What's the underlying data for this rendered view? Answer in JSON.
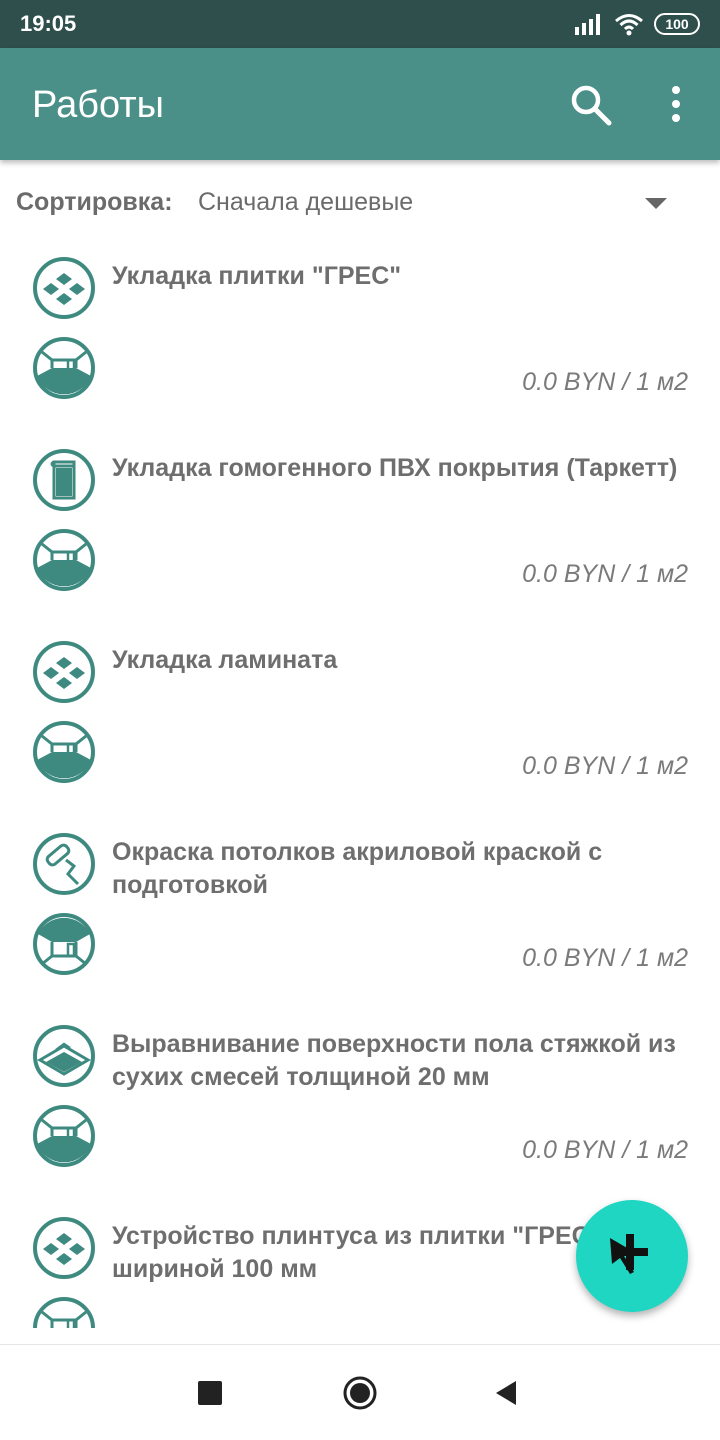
{
  "status_bar": {
    "time": "19:05",
    "battery": "100",
    "icons": [
      "signal-icon",
      "wifi-icon",
      "battery-icon"
    ]
  },
  "app_bar": {
    "title": "Работы",
    "actions": [
      "search-icon",
      "more-vert-icon"
    ],
    "color": "#4a8f88"
  },
  "sort": {
    "label": "Сортировка:",
    "value": "Сначала дешевые"
  },
  "items": [
    {
      "name": "Укладка плитки \"ГРЕС\"",
      "price": "0.0 BYN / 1 м2",
      "category_icon": "tiles-icon",
      "room_icon": "room-icon"
    },
    {
      "name": "Укладка гомогенного ПВХ покрытия (Таркетт)",
      "price": "0.0 BYN / 1 м2",
      "category_icon": "roll-covering-icon",
      "room_icon": "room-icon"
    },
    {
      "name": "Укладка ламината",
      "price": "0.0 BYN / 1 м2",
      "category_icon": "tiles-icon",
      "room_icon": "room-icon"
    },
    {
      "name": "Окраска потолков акриловой краской с подготовкой",
      "price": "0.0 BYN / 1 м2",
      "category_icon": "paint-roller-icon",
      "room_icon": "room-ceiling-icon"
    },
    {
      "name": "Выравнивание поверхности пола стяжкой из сухих смесей толщиной 20 мм",
      "price": "0.0 BYN / 1 м2",
      "category_icon": "screed-icon",
      "room_icon": "room-icon"
    },
    {
      "name": "Устройство плинтуса из плитки \"ГРЕС\" шириной 100 мм",
      "price": "",
      "category_icon": "tiles-icon",
      "room_icon": "room-icon"
    }
  ],
  "fab": {
    "icon": "add-icon",
    "color": "#1ed6c2"
  },
  "nav_bar": {
    "icons": [
      "recent-apps-icon",
      "home-icon",
      "back-icon"
    ]
  }
}
